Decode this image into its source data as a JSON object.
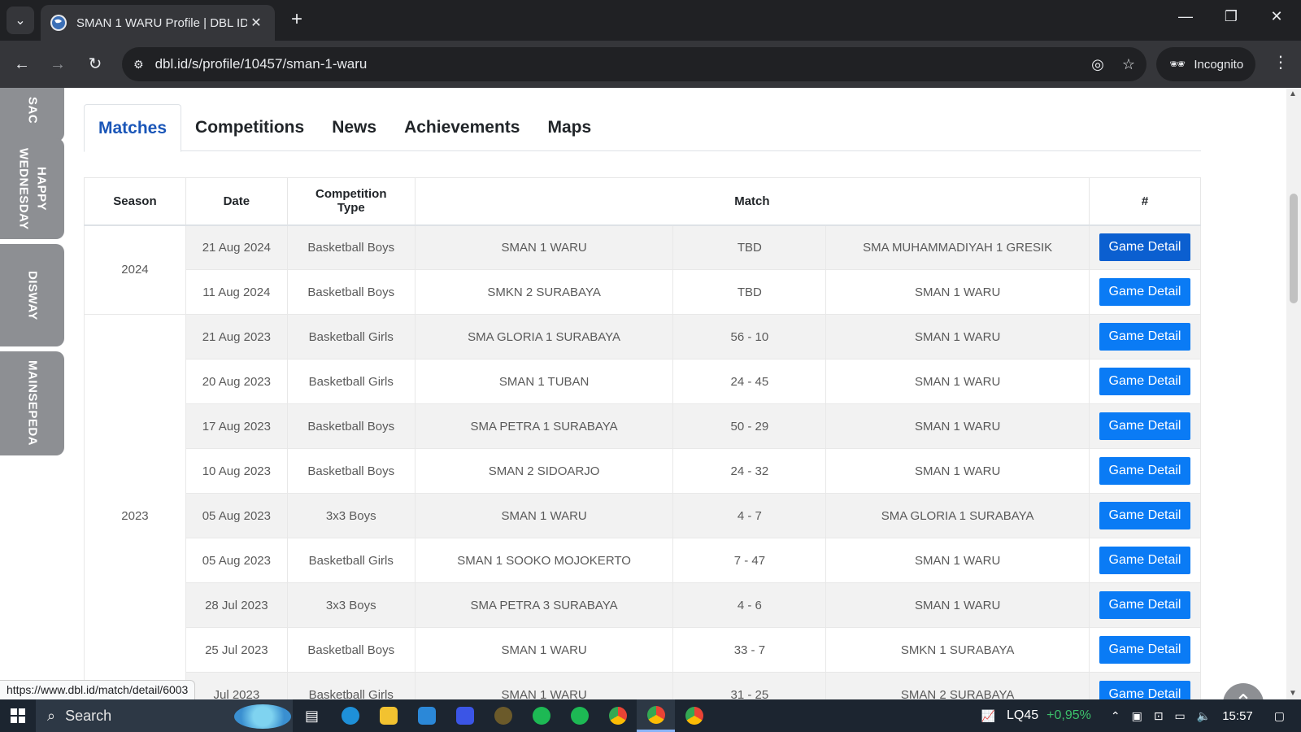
{
  "browser": {
    "tab_title": "SMAN 1 WARU Profile | DBL ID",
    "url": "dbl.id/s/profile/10457/sman-1-waru",
    "incognito_label": "Incognito"
  },
  "side_tabs": [
    "SAC",
    "HAPPY WEDNESDAY",
    "DISWAY",
    "MAINSEPEDA"
  ],
  "tabs": [
    "Matches",
    "Competitions",
    "News",
    "Achievements",
    "Maps"
  ],
  "table": {
    "headers": [
      "Season",
      "Date",
      "Competition Type",
      "Match",
      "#"
    ],
    "seasons": [
      "2024",
      "2023"
    ],
    "rows": [
      {
        "date": "21 Aug 2024",
        "type": "Basketball Boys",
        "home": "SMAN 1 WARU",
        "score": "TBD",
        "away": "SMA MUHAMMADIYAH 1 GRESIK",
        "action": "Game Detail"
      },
      {
        "date": "11 Aug 2024",
        "type": "Basketball Boys",
        "home": "SMKN 2 SURABAYA",
        "score": "TBD",
        "away": "SMAN 1 WARU",
        "action": "Game Detail"
      },
      {
        "date": "21 Aug 2023",
        "type": "Basketball Girls",
        "home": "SMA GLORIA 1 SURABAYA",
        "score": "56 - 10",
        "away": "SMAN 1 WARU",
        "action": "Game Detail"
      },
      {
        "date": "20 Aug 2023",
        "type": "Basketball Girls",
        "home": "SMAN 1 TUBAN",
        "score": "24 - 45",
        "away": "SMAN 1 WARU",
        "action": "Game Detail"
      },
      {
        "date": "17 Aug 2023",
        "type": "Basketball Boys",
        "home": "SMA PETRA 1 SURABAYA",
        "score": "50 - 29",
        "away": "SMAN 1 WARU",
        "action": "Game Detail"
      },
      {
        "date": "10 Aug 2023",
        "type": "Basketball Boys",
        "home": "SMAN 2 SIDOARJO",
        "score": "24 - 32",
        "away": "SMAN 1 WARU",
        "action": "Game Detail"
      },
      {
        "date": "05 Aug 2023",
        "type": "3x3 Boys",
        "home": "SMAN 1 WARU",
        "score": "4 - 7",
        "away": "SMA GLORIA 1 SURABAYA",
        "action": "Game Detail"
      },
      {
        "date": "05 Aug 2023",
        "type": "Basketball Girls",
        "home": "SMAN 1 SOOKO MOJOKERTO",
        "score": "7 - 47",
        "away": "SMAN 1 WARU",
        "action": "Game Detail"
      },
      {
        "date": "28 Jul 2023",
        "type": "3x3 Boys",
        "home": "SMA PETRA 3 SURABAYA",
        "score": "4 - 6",
        "away": "SMAN 1 WARU",
        "action": "Game Detail"
      },
      {
        "date": "25 Jul 2023",
        "type": "Basketball Boys",
        "home": "SMAN 1 WARU",
        "score": "33 - 7",
        "away": "SMKN 1 SURABAYA",
        "action": "Game Detail"
      },
      {
        "date": "Jul 2023",
        "type": "Basketball Girls",
        "home": "SMAN 1 WARU",
        "score": "31 - 25",
        "away": "SMAN 2 SURABAYA",
        "action": "Game Detail"
      }
    ]
  },
  "status_url": "https://www.dbl.id/match/detail/6003",
  "taskbar": {
    "search_label": "Search",
    "stock_name": "LQ45",
    "stock_change": "+0,95%",
    "clock": "15:57"
  },
  "colors": {
    "accent": "#0a7bf5",
    "tab_active": "#1a56b8",
    "side_tab": "#8d8f93"
  }
}
